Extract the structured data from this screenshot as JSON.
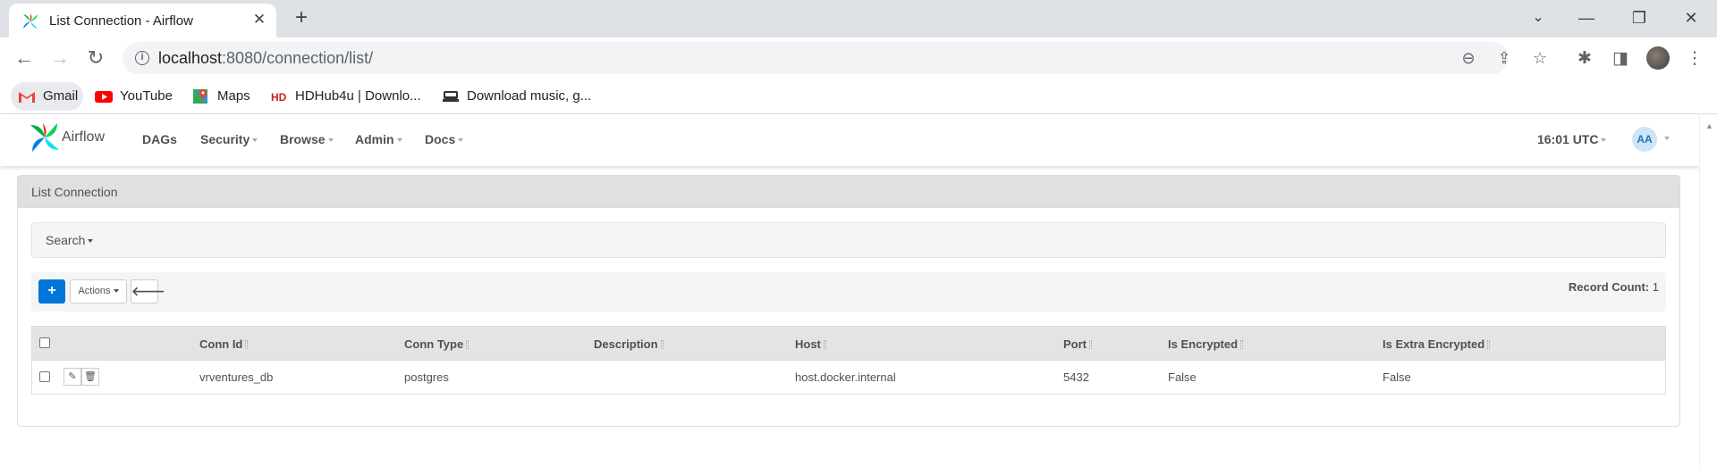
{
  "browser": {
    "tab_title": "List Connection - Airflow",
    "tab_close": "✕",
    "new_tab": "+",
    "window": {
      "minimize": "⌄",
      "restore": "—",
      "maximize": "❐",
      "close": "✕"
    },
    "url_host": "localhost",
    "url_path": ":8080/connection/list/",
    "icons": [
      "back-icon",
      "forward-icon",
      "reload-icon",
      "zoom-icon",
      "share-icon",
      "star-icon",
      "extensions-icon",
      "sidepanel-icon",
      "profile-avatar",
      "menu-icon"
    ]
  },
  "bookmarks": [
    {
      "label": "Gmail",
      "icon": "gmail-icon"
    },
    {
      "label": "YouTube",
      "icon": "youtube-icon"
    },
    {
      "label": "Maps",
      "icon": "maps-icon"
    },
    {
      "label": "HDHub4u | Downlo...",
      "icon": "hd-icon"
    },
    {
      "label": "Download music, g...",
      "icon": "music-icon"
    }
  ],
  "nav": {
    "brand": "Airflow",
    "items": [
      "DAGs",
      "Security",
      "Browse",
      "Admin",
      "Docs"
    ],
    "time": "16:01 UTC",
    "user_initials": "AA"
  },
  "panel": {
    "title": "List Connection",
    "search_label": "Search",
    "actions_label": "Actions",
    "record_count_label": "Record Count:",
    "record_count": "1"
  },
  "table": {
    "columns": [
      "Conn Id",
      "Conn Type",
      "Description",
      "Host",
      "Port",
      "Is Encrypted",
      "Is Extra Encrypted"
    ],
    "rows": [
      [
        "vrventures_db",
        "postgres",
        "",
        "host.docker.internal",
        "5432",
        "False",
        "False"
      ]
    ]
  },
  "colors": {
    "primary": "#0275d8",
    "text": "#51504f",
    "header_bg": "#e0e0e0"
  }
}
